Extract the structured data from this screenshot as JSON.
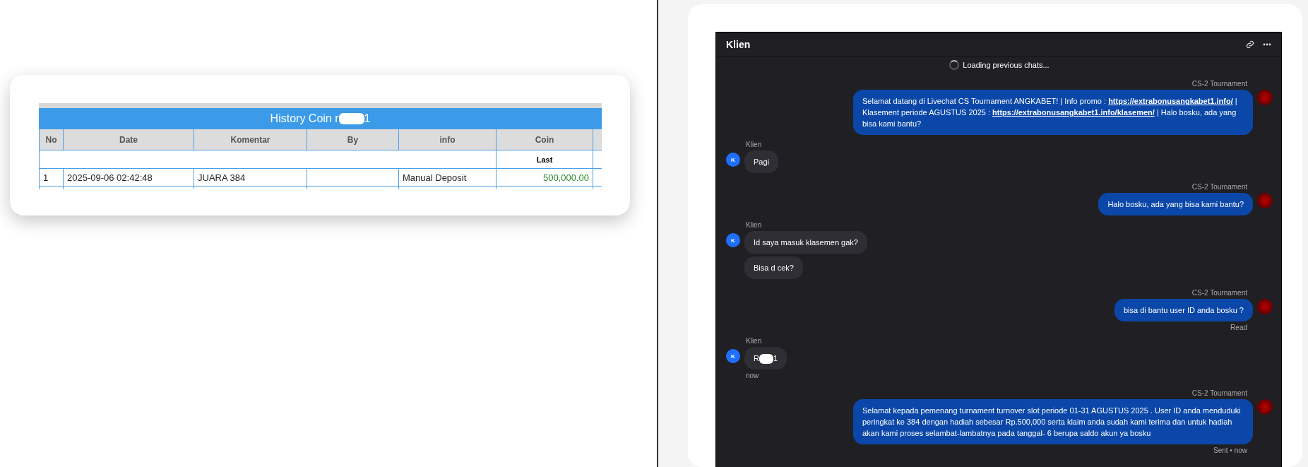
{
  "history": {
    "title_start": "History Coin r",
    "title_end": "1",
    "columns": [
      "No",
      "Date",
      "Komentar",
      "By",
      "info",
      "Coin"
    ],
    "subheader": "Last",
    "rows": [
      {
        "cells": [
          "1",
          "2025-09-06 02:42:48",
          "JUARA 384",
          "",
          "Manual Deposit",
          "500,000.00"
        ]
      }
    ]
  },
  "chat": {
    "title": "Klien",
    "loading": "Loading previous chats...",
    "messages": [
      {
        "kind": "agent",
        "sender": "CS-2 Tournament",
        "text": "Selamat datang di Livechat CS Tournament ANGKABET! | Info promo : **https://extrabonusangkabet1.info/** | Klasement periode AGUSTUS 2025 : **https://extrabonusangkabet1.info/klasemen/** | Halo bosku, ada yang bisa kami bantu?"
      },
      {
        "kind": "client",
        "sender": "Klien",
        "avatar": "K",
        "bubbles": [
          "Pagi"
        ]
      },
      {
        "kind": "agent",
        "sender": "CS-2 Tournament",
        "text": "Halo bosku, ada yang bisa kami bantu?"
      },
      {
        "kind": "client",
        "sender": "Klien",
        "avatar": "K",
        "bubbles": [
          "Id saya masuk klasemen gak?",
          "Bisa d cek?"
        ]
      },
      {
        "kind": "agent",
        "sender": "CS-2 Tournament",
        "text": "bisa di bantu user ID anda bosku ?",
        "status": "Read"
      },
      {
        "kind": "client",
        "sender": "Klien",
        "avatar": "K",
        "redacted": {
          "start": "R",
          "end": "1"
        },
        "status": "now"
      },
      {
        "kind": "agent",
        "sender": "CS-2 Tournament",
        "text": "Selamat kepada pemenang turnament turnover slot periode 01-31 AGUSTUS 2025 . User ID anda menduduki peringkat ke 384 dengan hadiah sebesar Rp.500,000 serta klaim anda sudah kami terima dan untuk hadiah akan kami proses selambat-lambatnya pada tanggal- 6 berupa saldo akun ya bosku",
        "status": "Sent • now"
      }
    ]
  }
}
